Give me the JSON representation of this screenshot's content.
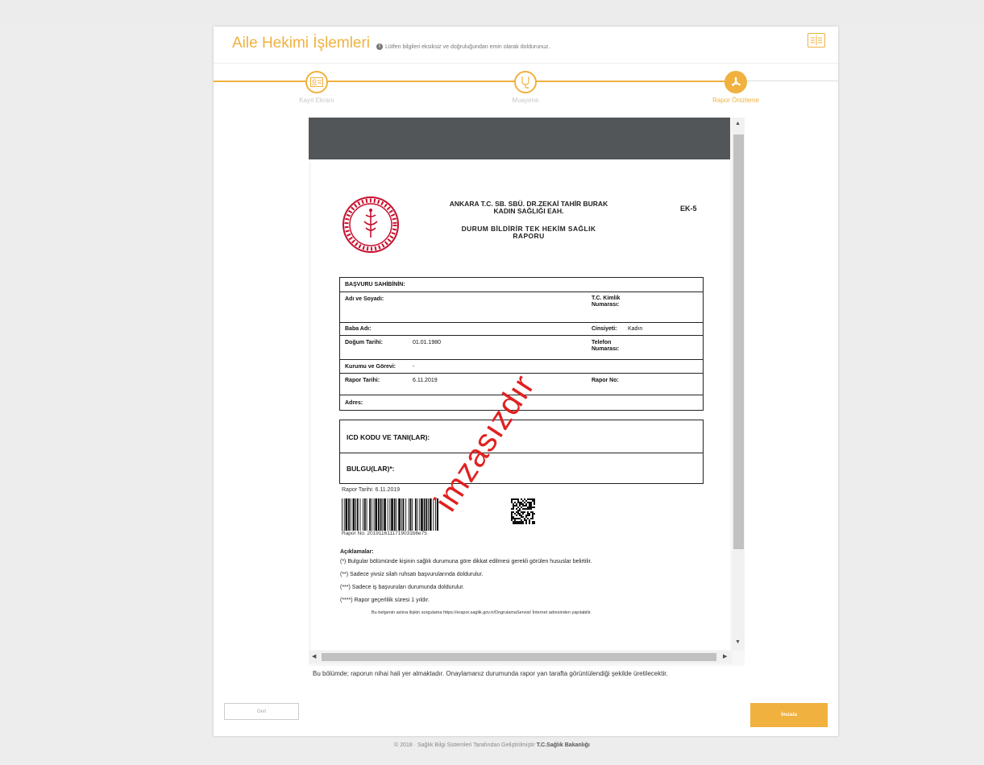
{
  "header": {
    "title": "Aile Hekimi İşlemleri",
    "info": "Lütfen bilgileri eksiksiz ve doğruluğundan emin olarak doldurunuz."
  },
  "steps": [
    {
      "label": "Kayıt Ekranı",
      "icon": "id-card-icon"
    },
    {
      "label": "Muayene",
      "icon": "stethoscope-icon"
    },
    {
      "label": "Rapor Önizleme",
      "icon": "pdf-icon"
    }
  ],
  "document": {
    "hospital": "ANKARA T.C. SB. SBÜ. DR.ZEKAİ TAHİR BURAK KADIN SAĞLIĞI EAH.",
    "title": "DURUM BİLDİRİR TEK HEKİM SAĞLIK RAPORU",
    "code": "EK-5",
    "section_title": "BAŞVURU SAHİBİNİN:",
    "fields": {
      "name_label": "Adı ve Soyadı:",
      "tc_label": "T.C. Kimlik Numarası:",
      "father_label": "Baba Adı:",
      "gender_label": "Cinsiyeti:",
      "gender_value": "Kadın",
      "birth_label": "Doğum Tarihi:",
      "birth_value": "01.01.1980",
      "phone_label": "Telefon Numarası:",
      "job_label": "Kurumu ve Görevi:",
      "job_value": "-",
      "report_date_label": "Rapor Tarihi:",
      "report_date_value": "6.11.2019",
      "report_no_label": "Rapor No:",
      "address_label": "Adres:"
    },
    "icd_label": "ICD KODU VE TANI(LAR):",
    "findings_label": "BULGU(LAR)*:",
    "footer_date": "Rapor Tarihi: 6.11.2019",
    "footer_no": "Rapor No: 2019116111719031b6e75",
    "notes_title": "Açıklamalar:",
    "notes": [
      "(*) Bulgular bölümünde kişinin sağlık durumuna göre dikkat edilmesi gerekli görülen hususlar belirtilir.",
      "(**) Sadece yivsiz silah ruhsatı başvurularında doldurulur.",
      "(***) Sadece iş başvuruları durumunda doldurulur.",
      "(****) Rapor geçerlilik süresi 1 yıldır."
    ],
    "verify": "Bu belgenin aslına ilişkin sorgulama https://erapor.saglik.gov.tr/DogrulamaServisi/ İnternet adresinden yapılabilir.",
    "watermark": "imzasızdır"
  },
  "footnote": "Bu bölümde; raporun nihai hali yer almaktadır. Onaylamanız durumunda rapor yan tarafta görüntülendiği şekilde üretilecektir.",
  "buttons": {
    "back": "Geri",
    "sign": "İmzala"
  },
  "footer": {
    "prefix": "© 2018 · Sağlık Bilgi Sistemleri Tarafından Geliştirilmiştir",
    "org": "T.C.Sağlık Bakanlığı"
  },
  "colors": {
    "accent": "#f0b13e",
    "watermark": "#e12020"
  }
}
